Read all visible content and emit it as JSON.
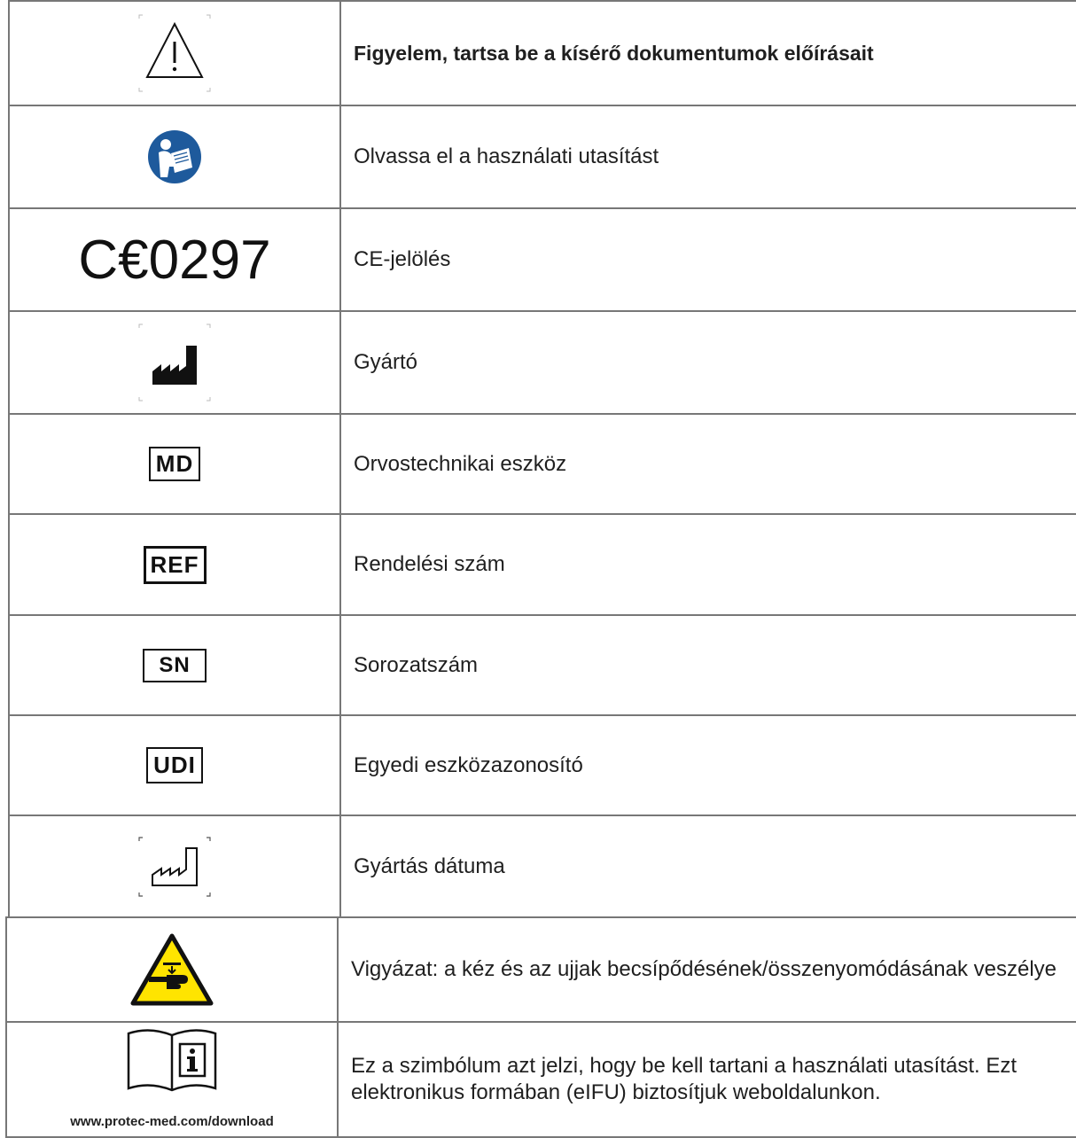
{
  "rows": [
    {
      "symbol": "warning-triangle",
      "label": "Figyelem, tartsa be a kísérő dokumentumok előírásait"
    },
    {
      "symbol": "read-manual-blue",
      "label": "Olvassa el a használati utasítást"
    },
    {
      "symbol": "ce-mark",
      "ce_number": "C€0297",
      "label": "CE-jelölés"
    },
    {
      "symbol": "manufacturer-factory",
      "label": "Gyártó"
    },
    {
      "symbol": "md-box",
      "icon_text": "MD",
      "label": "Orvostechnikai eszköz"
    },
    {
      "symbol": "ref-box",
      "icon_text": "REF",
      "label": "Rendelési szám"
    },
    {
      "symbol": "sn-box",
      "icon_text": "SN",
      "label": "Sorozatszám"
    },
    {
      "symbol": "udi-box",
      "icon_text": "UDI",
      "label": "Egyedi eszközazonosító"
    },
    {
      "symbol": "date-of-manufacture-factory",
      "label": "Gyártás dátuma"
    },
    {
      "symbol": "hand-crush-warning-yellow",
      "label": "Vigyázat: a kéz és az ujjak becsípődésének/összenyomódásának veszélye"
    },
    {
      "symbol": "eifu-book-info",
      "url": "www.protec-med.com/download",
      "label": "Ez a szimbólum azt jelzi, hogy be kell tartani a használati utasítást. Ezt elektronikus formában (eIFU) biztosítjuk weboldalunkon."
    }
  ],
  "colors": {
    "border": "#777777",
    "manual_blue": "#1e5a9c",
    "warning_yellow": "#ffe400"
  }
}
